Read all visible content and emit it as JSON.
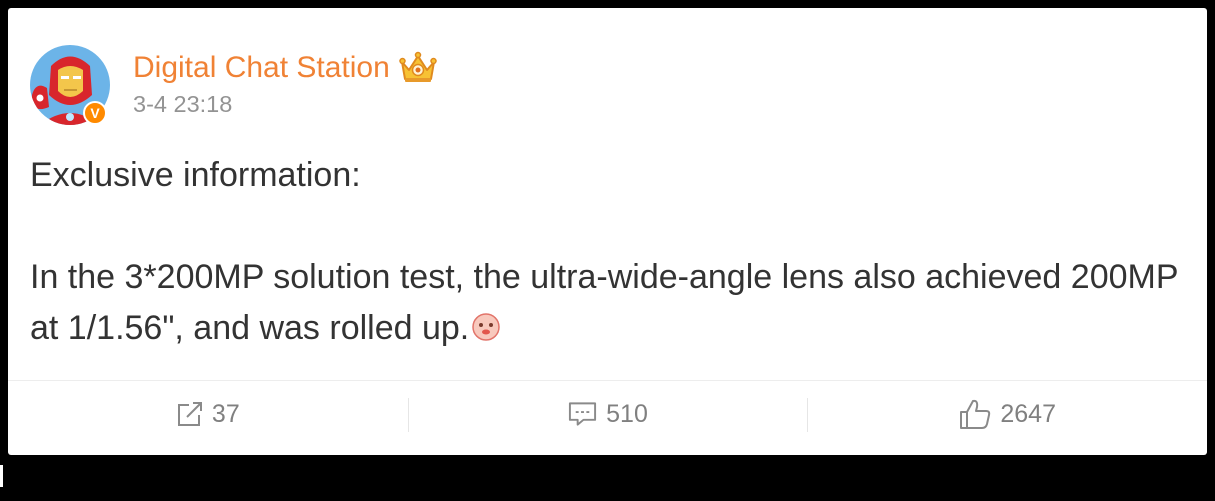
{
  "post": {
    "author": {
      "name": "Digital Chat Station",
      "avatar_icon": "iron-man-avatar-icon",
      "verified_badge_label": "V",
      "member_badge_icon": "crown-icon"
    },
    "timestamp": "3-4 23:18",
    "body": {
      "heading": "Exclusive information:",
      "paragraph": "In the 3*200MP solution test, the ultra-wide-angle lens also achieved 200MP at 1/1.56\", and was rolled up.",
      "trailing_emoji_icon": "pink-face-emoji-icon"
    },
    "actions": {
      "repost": {
        "icon": "share-icon",
        "count": "37"
      },
      "comment": {
        "icon": "comment-icon",
        "count": "510"
      },
      "like": {
        "icon": "like-icon",
        "count": "2647"
      }
    }
  },
  "colors": {
    "background": "#000000",
    "card": "#ffffff",
    "author_name": "#f08235",
    "timestamp": "#939393",
    "body_text": "#333333",
    "action_text": "#808080",
    "verified_badge": "#ff8a00",
    "crown": "#f7c234"
  }
}
